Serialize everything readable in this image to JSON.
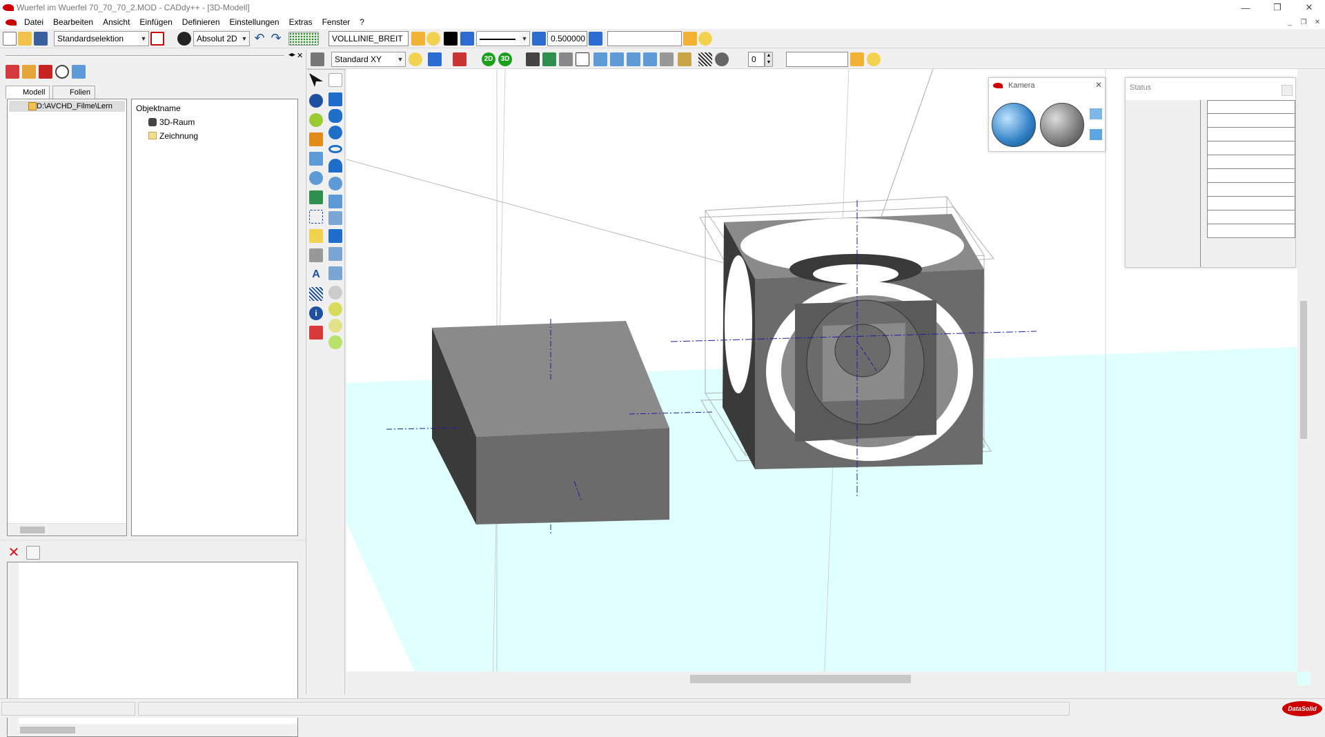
{
  "window": {
    "title": "Wuerfel im Wuerfel 70_70_70_2.MOD  -  CADdy++ - [3D-Modell]",
    "min": "—",
    "restore": "❐",
    "close": "✕"
  },
  "menu": [
    "Datei",
    "Bearbeiten",
    "Ansicht",
    "Einfügen",
    "Definieren",
    "Einstellungen",
    "Extras",
    "Fenster",
    "?"
  ],
  "mdi_controls": [
    "_",
    "❐",
    "✕"
  ],
  "toolbar1": {
    "selection_mode": "Standardselektion",
    "coord_mode": "Absolut 2D",
    "layer_name": "VOLLLINIE_BREIT",
    "line_width": "0.500000",
    "empty_field": ""
  },
  "toolbar2": {
    "view_plane": "Standard XY",
    "btn_2d": "2D",
    "btn_3d": "3D",
    "spinner_value": "0",
    "empty_field": ""
  },
  "tabs": {
    "model": "Modell",
    "layers": "Folien"
  },
  "file_tree": {
    "path": "D:\\AVCHD_Filme\\Lern"
  },
  "object_tree": {
    "header": "Objektname",
    "items": [
      "3D-Raum",
      "Zeichnung"
    ]
  },
  "camera_panel": {
    "title": "Kamera"
  },
  "status_panel": {
    "title": "Status"
  },
  "colors": {
    "ground": "#e0ffff",
    "solid_dark": "#3a3a3a",
    "solid_mid": "#6b6b6b",
    "solid_light": "#8a8a8a",
    "axis": "#1a1aa0",
    "brand_red": "#cc0000"
  },
  "icons": [
    "new-file-icon",
    "open-file-icon",
    "save-icon",
    "undo-icon",
    "redo-icon",
    "grid-icon",
    "layer-icon",
    "bulb-icon",
    "pan-hand-icon",
    "zoom-icon",
    "rotate-icon",
    "camera-globe-icon",
    "info-icon",
    "eraser-icon",
    "pencil-icon",
    "text-icon",
    "hatch-icon"
  ],
  "logo": "DataSolid"
}
